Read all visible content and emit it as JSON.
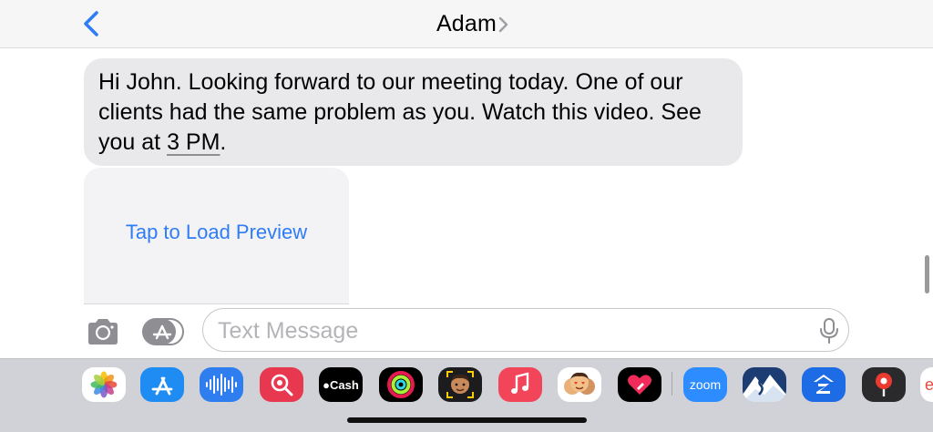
{
  "header": {
    "contact_name": "Adam"
  },
  "message": {
    "text_before_time": "Hi John. Looking forward to our meeting today. One of our clients had the same problem as you. Watch this video. See you at ",
    "time_link": "3 PM",
    "text_after_time": "."
  },
  "link_preview": {
    "label": "Tap to Load Preview"
  },
  "composer": {
    "placeholder": "Text Message",
    "value": ""
  },
  "app_drawer": {
    "apps": [
      {
        "name": "Photos",
        "icon": "photos-icon"
      },
      {
        "name": "App Store",
        "icon": "app-store-icon"
      },
      {
        "name": "Audio",
        "icon": "audio-waveform-icon"
      },
      {
        "name": "Images Search",
        "icon": "images-search-icon"
      },
      {
        "name": "Apple Cash",
        "icon": "apple-cash-icon",
        "label": "Cash"
      },
      {
        "name": "Activity",
        "icon": "activity-rings-icon"
      },
      {
        "name": "Memoji",
        "icon": "memoji-icon"
      },
      {
        "name": "Music",
        "icon": "music-icon"
      },
      {
        "name": "Memoji Stickers",
        "icon": "memoji-stickers-icon"
      },
      {
        "name": "Digital Touch",
        "icon": "digital-touch-icon"
      },
      {
        "name": "Zoom",
        "icon": "zoom-icon",
        "label": "zoom"
      },
      {
        "name": "Mountains",
        "icon": "mountain-icon"
      },
      {
        "name": "Zillow",
        "icon": "zillow-icon"
      },
      {
        "name": "Location",
        "icon": "map-pin-icon"
      },
      {
        "name": "Partial App",
        "icon": "partial-app-icon"
      }
    ]
  },
  "colors": {
    "accent_blue": "#2e7cf6",
    "bubble_gray": "#e9e9eb",
    "drawer_bg": "#d1d2d7"
  }
}
